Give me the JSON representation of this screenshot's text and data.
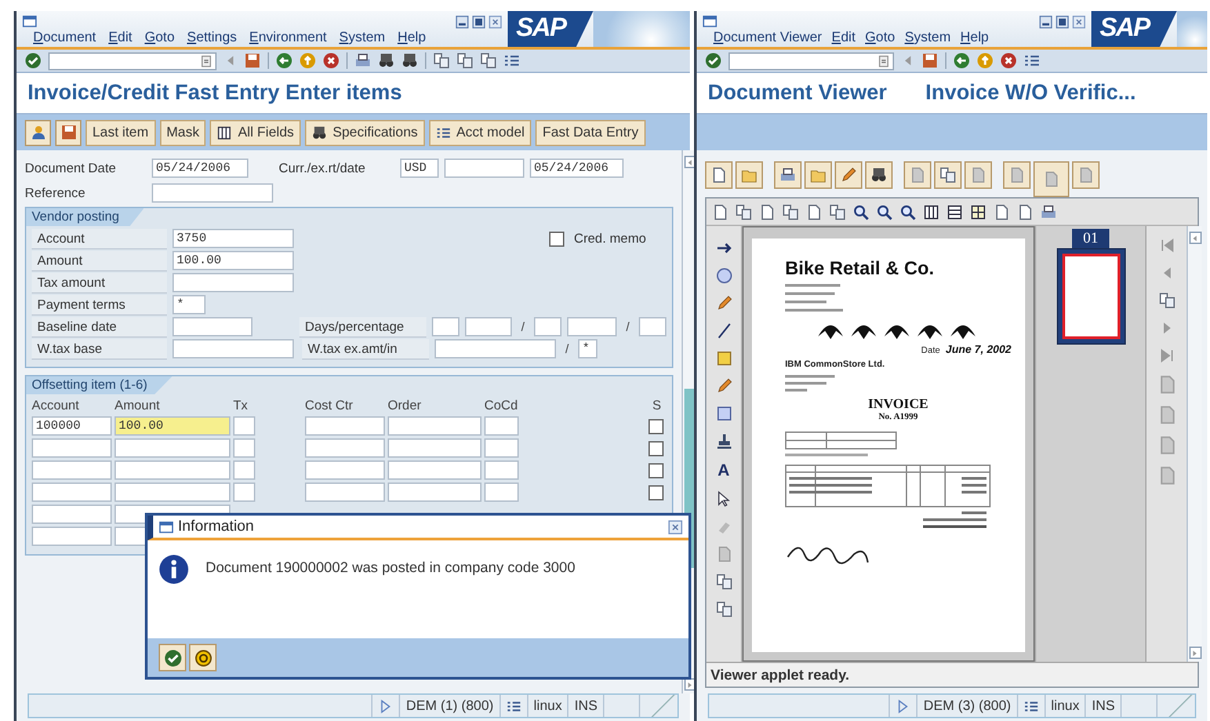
{
  "left_window": {
    "logo": "SAP",
    "menu": [
      "Document",
      "Edit",
      "Goto",
      "Settings",
      "Environment",
      "System",
      "Help"
    ],
    "title": "Invoice/Credit Fast Entry Enter items",
    "app_buttons": [
      "Last item",
      "Mask",
      "All Fields",
      "Specifications",
      "Acct model",
      "Fast Data Entry"
    ],
    "header": {
      "document_date": {
        "label": "Document Date",
        "value": "05/24/2006"
      },
      "currency": {
        "label": "Curr./ex.rt/date",
        "currency": "USD",
        "date": "05/24/2006"
      },
      "reference": {
        "label": "Reference"
      }
    },
    "vendor_posting": {
      "title": "Vendor posting",
      "fields": [
        {
          "label": "Account",
          "value": "3750"
        },
        {
          "label": "Amount",
          "value": "100.00"
        },
        {
          "label": "Tax amount"
        },
        {
          "label": "Payment terms",
          "value": "*"
        },
        {
          "label": "Baseline date"
        },
        {
          "label": "W.tax base"
        }
      ],
      "cred_memo": {
        "label": "Cred. memo",
        "checked": false
      },
      "days_percentage": {
        "label": "Days/percentage",
        "separators": [
          "/",
          "/"
        ]
      },
      "wtax_exempt": {
        "label": "W.tax ex.amt/in",
        "separator": "/",
        "indicator": "*"
      }
    },
    "offsetting": {
      "title": "Offsetting item (1-6)",
      "columns": [
        "Account",
        "Amount",
        "Tx",
        "Cost Ctr",
        "Order",
        "CoCd",
        "S"
      ],
      "rows": [
        {
          "account": "100000",
          "amount": "100.00",
          "active": true,
          "s": false
        },
        {
          "active": false,
          "s": false
        },
        {
          "active": false,
          "s": false
        },
        {
          "active": false,
          "s": false
        },
        {
          "active": false
        },
        {
          "active": false
        }
      ]
    },
    "status": {
      "session": "DEM (1) (800)",
      "server": "linux",
      "mode": "INS"
    }
  },
  "dialog": {
    "title": "Information",
    "message": "Document 190000002 was posted in company code 3000"
  },
  "right_window": {
    "logo": "SAP",
    "menu": [
      "Document Viewer",
      "Edit",
      "Goto",
      "System",
      "Help"
    ],
    "title": "Document Viewer",
    "subtitle": "Invoice W/O Verific...",
    "document": {
      "company": "Bike Retail & Co.",
      "date_label": "Date",
      "date": "June 7, 2002",
      "recipient": "IBM CommonStore Ltd.",
      "heading": "INVOICE",
      "number": "No. A1999"
    },
    "text_tool": "A",
    "page_label": "01",
    "viewer_status": "Viewer applet ready.",
    "status": {
      "session": "DEM (3) (800)",
      "server": "linux",
      "mode": "INS"
    }
  }
}
